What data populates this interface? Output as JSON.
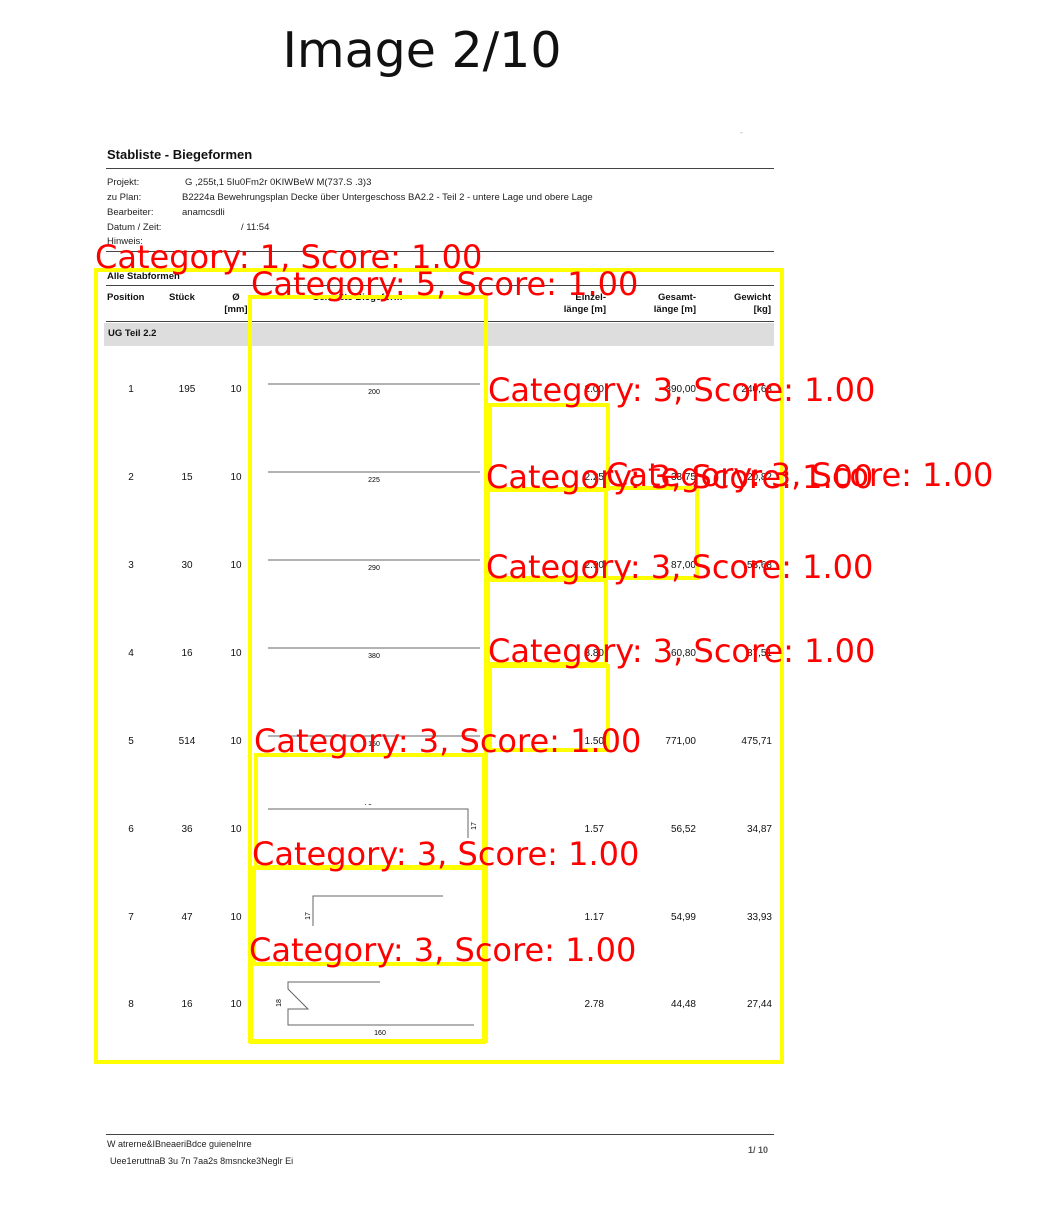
{
  "image_title": "Image 2/10",
  "corner_mark": "-",
  "document": {
    "title": "Stabliste - Biegeformen",
    "meta": [
      {
        "label": "Projekt:",
        "value": "G ,255t,1 5Iu0Fm2r 0KIWBeW     M(737.S .3)3"
      },
      {
        "label": "zu Plan:",
        "value": "B2224a Bewehrungsplan Decke über Untergeschoss BA2.2 - Teil 2 - untere Lage und obere Lage"
      },
      {
        "label": "Bearbeiter:",
        "value": "anamcsdli"
      },
      {
        "label": "Datum / Zeit:",
        "value": "/  11:54"
      },
      {
        "label": "Hinweis:",
        "value": ""
      }
    ],
    "section_title": "Alle Stabformen",
    "headers": {
      "position": "Position",
      "qty": "Stück",
      "dia_1": "Ø",
      "dia_2": "[mm]",
      "shape": "Gemaßte Biegeform",
      "len_1": "Einzel-",
      "len_2": "länge [m]",
      "tot_1": "Gesamt-",
      "tot_2": "länge [m]",
      "wgt_1": "Gewicht",
      "wgt_2": "[kg]"
    },
    "group_label": "UG Teil 2.2",
    "rows": [
      {
        "position": "1",
        "qty": "195",
        "dia": "10",
        "shape_dims": [
          "200"
        ],
        "length": "2.00",
        "total": "390,00",
        "weight": "240,63"
      },
      {
        "position": "2",
        "qty": "15",
        "dia": "10",
        "shape_dims": [
          "225"
        ],
        "length": "2.25",
        "total": "33,75",
        "weight": "20,82"
      },
      {
        "position": "3",
        "qty": "30",
        "dia": "10",
        "shape_dims": [
          "290"
        ],
        "length": "2.90",
        "total": "87,00",
        "weight": "53,68"
      },
      {
        "position": "4",
        "qty": "16",
        "dia": "10",
        "shape_dims": [
          "380"
        ],
        "length": "3.80",
        "total": "60,80",
        "weight": "37,51"
      },
      {
        "position": "5",
        "qty": "514",
        "dia": "10",
        "shape_dims": [
          "150"
        ],
        "length": "1.50",
        "total": "771,00",
        "weight": "475,71"
      },
      {
        "position": "6",
        "qty": "36",
        "dia": "10",
        "shape_dims": [
          "70",
          "17"
        ],
        "length": "1.57",
        "total": "56,52",
        "weight": "34,87"
      },
      {
        "position": "7",
        "qty": "47",
        "dia": "10",
        "shape_dims": [
          "50",
          "17"
        ],
        "length": "1.17",
        "total": "54,99",
        "weight": "33,93"
      },
      {
        "position": "8",
        "qty": "16",
        "dia": "10",
        "shape_dims": [
          "100",
          "18",
          "160"
        ],
        "length": "2.78",
        "total": "44,48",
        "weight": "27,44"
      }
    ],
    "footer": {
      "line1": "W atrerne&IBneaeriBdce      guieneInre",
      "line2": "Uee1eruttnaB 3u    7n 7aa2s 8msncke3Neglr Ei",
      "page": "1/  10"
    }
  },
  "annotations": [
    {
      "label": "Category: 1, Score: 1.00"
    },
    {
      "label": "Category: 5, Score: 1.00"
    },
    {
      "label": "Category: 3, Score: 1.00"
    },
    {
      "label": "Category: 3, Score: 1.00"
    },
    {
      "label": "Category: 3, Score: 1.00"
    },
    {
      "label": "Category: 3, Score: 1.00"
    },
    {
      "label": "Category: 3, Score: 1.00"
    },
    {
      "label": "Category: 3, Score: 1.00"
    },
    {
      "label": "Category: 3, Score: 1.00"
    },
    {
      "label": "Category: 3, Score: 1.00"
    }
  ],
  "colors": {
    "annotation_box": "#ffff00",
    "annotation_text": "#ff0000",
    "group_band": "#dddddd"
  }
}
